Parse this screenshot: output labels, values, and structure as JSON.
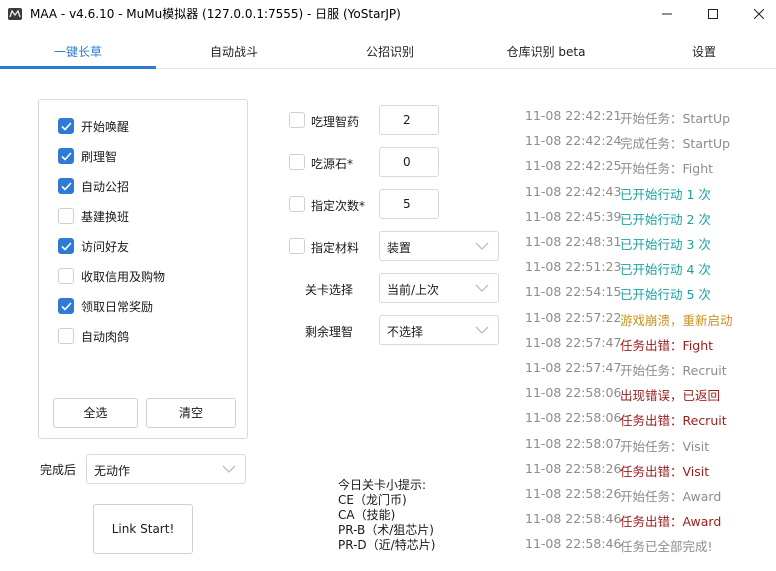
{
  "window": {
    "title": "MAA - v4.6.10 - MuMu模拟器 (127.0.0.1:7555) - 日服 (YoStarJP)"
  },
  "tabs": [
    {
      "label": "一键长草",
      "active": true
    },
    {
      "label": "自动战斗",
      "active": false
    },
    {
      "label": "公招识别",
      "active": false
    },
    {
      "label": "仓库识别 beta",
      "active": false
    },
    {
      "label": "设置",
      "active": false
    }
  ],
  "tasks": [
    {
      "label": "开始唤醒",
      "checked": true
    },
    {
      "label": "刷理智",
      "checked": true
    },
    {
      "label": "自动公招",
      "checked": true
    },
    {
      "label": "基建换班",
      "checked": false
    },
    {
      "label": "访问好友",
      "checked": true
    },
    {
      "label": "收取信用及购物",
      "checked": false
    },
    {
      "label": "领取日常奖励",
      "checked": true
    },
    {
      "label": "自动肉鸽",
      "checked": false
    }
  ],
  "task_buttons": {
    "select_all": "全选",
    "clear": "清空"
  },
  "after_complete": {
    "label": "完成后",
    "value": "无动作"
  },
  "start_button": "Link Start!",
  "options": {
    "medicine": {
      "label": "吃理智药",
      "value": "2",
      "checked": false
    },
    "stone": {
      "label": "吃源石*",
      "value": "0",
      "checked": false
    },
    "times": {
      "label": "指定次数*",
      "value": "5",
      "checked": false
    },
    "material": {
      "label": "指定材料",
      "value": "装置",
      "checked": false
    },
    "stage": {
      "label": "关卡选择",
      "value": "当前/上次"
    },
    "remaining": {
      "label": "剩余理智",
      "value": "不选择"
    }
  },
  "tips": {
    "title": "今日关卡小提示:",
    "lines": [
      "CE（龙门币)",
      "CA（技能)",
      "PR-B（术/狙芯片)",
      "PR-D（近/特芯片)"
    ]
  },
  "log": [
    {
      "time": "11-08  22:42:21",
      "msg": "开始任务：StartUp",
      "color": "#8c8c8c"
    },
    {
      "time": "11-08  22:42:24",
      "msg": "完成任务：StartUp",
      "color": "#8c8c8c"
    },
    {
      "time": "11-08  22:42:25",
      "msg": "开始任务：Fight",
      "color": "#8c8c8c"
    },
    {
      "time": "11-08  22:42:43",
      "msg": "已开始行动 1 次",
      "color": "#1aa1a1"
    },
    {
      "time": "11-08  22:45:39",
      "msg": "已开始行动 2 次",
      "color": "#1aa1a1"
    },
    {
      "time": "11-08  22:48:31",
      "msg": "已开始行动 3 次",
      "color": "#1aa1a1"
    },
    {
      "time": "11-08  22:51:23",
      "msg": "已开始行动 4 次",
      "color": "#1aa1a1"
    },
    {
      "time": "11-08  22:54:15",
      "msg": "已开始行动 5 次",
      "color": "#1aa1a1"
    },
    {
      "time": "11-08  22:57:22",
      "msg": "游戏崩溃，重新启动",
      "color": "#c9901c"
    },
    {
      "time": "11-08  22:57:47",
      "msg": "任务出错：Fight",
      "color": "#9b1c1c"
    },
    {
      "time": "11-08  22:57:47",
      "msg": "开始任务：Recruit",
      "color": "#8c8c8c"
    },
    {
      "time": "11-08  22:58:06",
      "msg": "出现错误，已返回",
      "color": "#9b1c1c"
    },
    {
      "time": "11-08  22:58:06",
      "msg": "任务出错：Recruit",
      "color": "#9b1c1c"
    },
    {
      "time": "11-08  22:58:07",
      "msg": "开始任务：Visit",
      "color": "#8c8c8c"
    },
    {
      "time": "11-08  22:58:26",
      "msg": "任务出错：Visit",
      "color": "#9b1c1c"
    },
    {
      "time": "11-08  22:58:26",
      "msg": "开始任务：Award",
      "color": "#8c8c8c"
    },
    {
      "time": "11-08  22:58:46",
      "msg": "任务出错：Award",
      "color": "#9b1c1c"
    },
    {
      "time": "11-08  22:58:46",
      "msg": "任务已全部完成!",
      "color": "#8c8c8c"
    }
  ]
}
